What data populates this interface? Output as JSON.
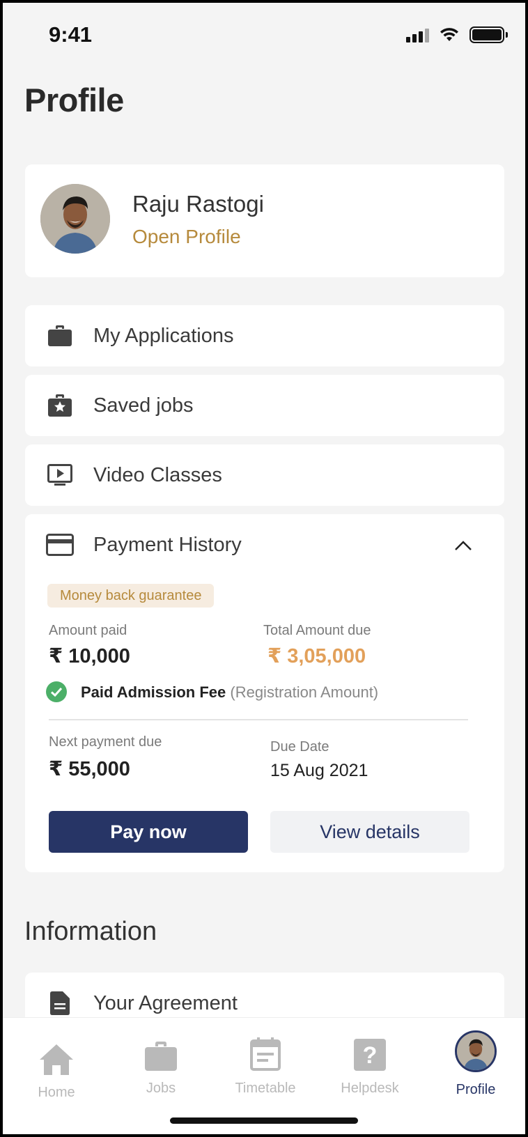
{
  "status_bar": {
    "time": "9:41"
  },
  "page": {
    "title": "Profile"
  },
  "profile": {
    "name": "Raju Rastogi",
    "link_label": "Open Profile"
  },
  "menu": {
    "applications": "My Applications",
    "saved_jobs": "Saved jobs",
    "video_classes": "Video Classes",
    "payment_history": "Payment History"
  },
  "payment": {
    "badge": "Money back guarantee",
    "amount_paid_label": "Amount paid",
    "amount_paid_value": "₹ 10,000",
    "total_due_label": "Total Amount due",
    "total_due_value": "₹ 3,05,000",
    "paid_fee_label": "Paid Admission Fee",
    "paid_fee_sub": "(Registration Amount)",
    "next_due_label": "Next payment due",
    "next_due_value": "₹ 55,000",
    "due_date_label": "Due Date",
    "due_date_value": "15 Aug 2021",
    "pay_button": "Pay now",
    "details_button": "View details"
  },
  "information": {
    "title": "Information",
    "agreement": "Your Agreement"
  },
  "tabs": {
    "home": "Home",
    "jobs": "Jobs",
    "timetable": "Timetable",
    "helpdesk": "Helpdesk",
    "profile": "Profile"
  },
  "colors": {
    "accent_gold": "#b68a3c",
    "due_orange": "#e2a05a",
    "primary_navy": "#273566",
    "success_green": "#4caf68"
  },
  "icons": [
    "briefcase-icon",
    "saved-jobs-icon",
    "video-icon",
    "credit-card-icon",
    "chevron-up-icon",
    "check-circle-icon",
    "document-icon",
    "home-icon",
    "jobs-icon",
    "timetable-icon",
    "helpdesk-icon"
  ]
}
